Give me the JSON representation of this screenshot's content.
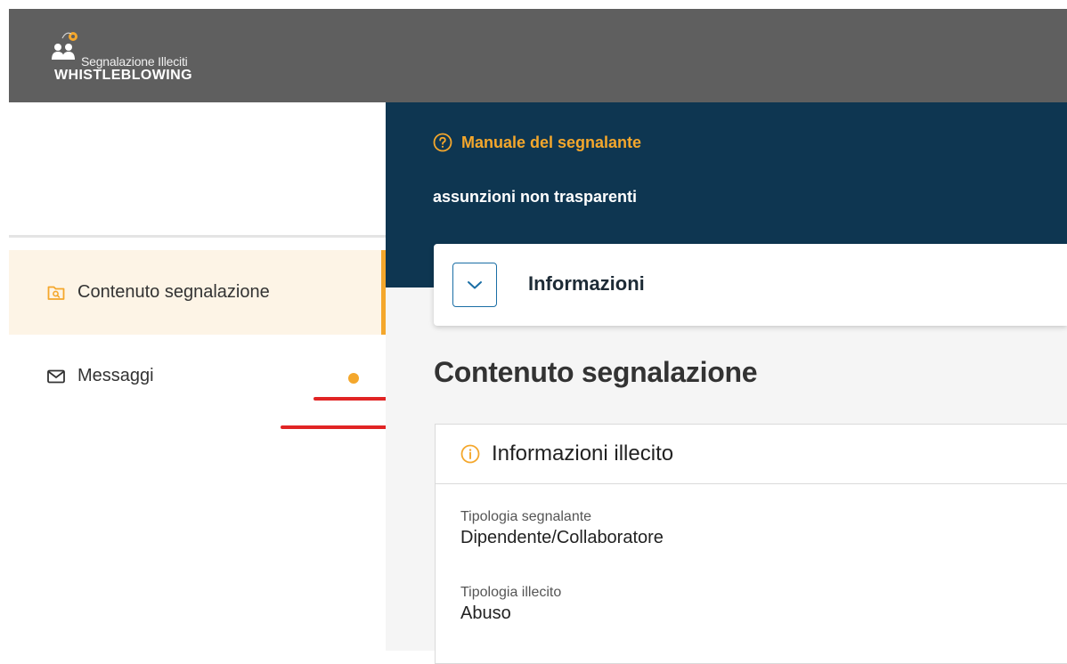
{
  "header": {
    "logo_subtitle": "Segnalazione Illeciti",
    "logo_title": "WHISTLEBLOWING"
  },
  "sidebar": {
    "items": [
      {
        "label": "Contenuto segnalazione",
        "icon": "folder-search-icon",
        "active": true
      },
      {
        "label": "Messaggi",
        "icon": "envelope-icon",
        "active": false,
        "unread": true
      }
    ]
  },
  "content": {
    "manual_link": "Manuale del segnalante",
    "report_title": "assunzioni non trasparenti",
    "info_panel_title": "Informazioni",
    "section_title": "Contenuto segnalazione",
    "detail": {
      "title": "Informazioni illecito",
      "fields": [
        {
          "label": "Tipologia segnalante",
          "value": "Dipendente/Collaboratore"
        },
        {
          "label": "Tipologia illecito",
          "value": "Abuso"
        }
      ]
    }
  },
  "colors": {
    "topbar": "#5f5f5f",
    "header_bg": "#0e3651",
    "accent": "#f4a72c",
    "active_bg": "#fdf4e6",
    "annotation_red": "#e12424"
  }
}
